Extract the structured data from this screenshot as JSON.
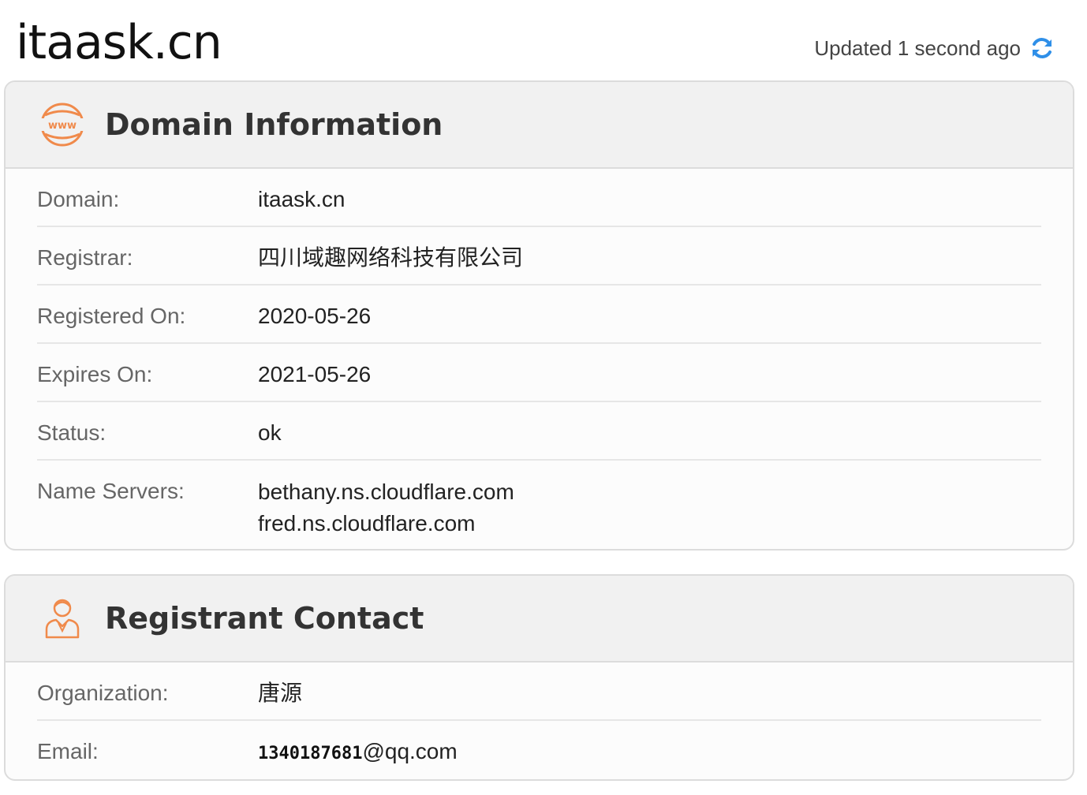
{
  "page": {
    "title": "itaask.cn",
    "updated_text": "Updated 1 second ago"
  },
  "colors": {
    "accent_orange": "#f08a4b",
    "refresh_blue": "#2f8fe8"
  },
  "icons": {
    "refresh": "refresh-icon",
    "domain_section": "www-globe-icon",
    "contact_section": "person-icon"
  },
  "domain_info": {
    "title": "Domain Information",
    "rows": [
      {
        "label": "Domain:",
        "value": "itaask.cn"
      },
      {
        "label": "Registrar:",
        "value": "四川域趣网络科技有限公司"
      },
      {
        "label": "Registered On:",
        "value": "2020-05-26"
      },
      {
        "label": "Expires On:",
        "value": "2021-05-26"
      },
      {
        "label": "Status:",
        "value": "ok"
      },
      {
        "label": "Name Servers:",
        "values": [
          "bethany.ns.cloudflare.com",
          "fred.ns.cloudflare.com"
        ]
      }
    ]
  },
  "registrant_contact": {
    "title": "Registrant Contact",
    "rows": [
      {
        "label": "Organization:",
        "value": "唐源"
      },
      {
        "label": "Email:",
        "value_image_text": "1340187681",
        "value_suffix": "@qq.com"
      }
    ]
  }
}
